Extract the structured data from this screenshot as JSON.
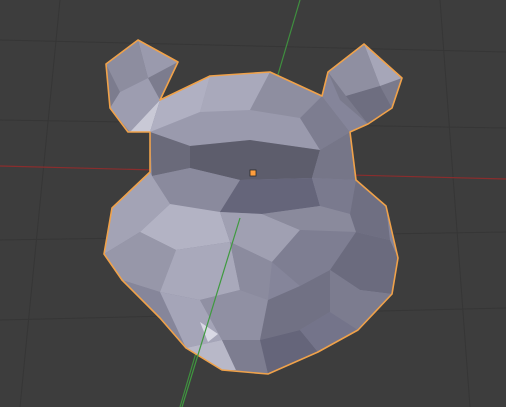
{
  "viewport": {
    "background": "#3d3d3d",
    "grid_color": "#343434",
    "x_axis_color": "#8a2d2d",
    "y_axis_color": "#3f8f3f",
    "selection_outline_color": "#f0a24a",
    "origin_marker_color": "#ff9e3d"
  },
  "object": {
    "label": "low-poly-bear-head",
    "selected": true,
    "base_color": "#8a8a98"
  }
}
